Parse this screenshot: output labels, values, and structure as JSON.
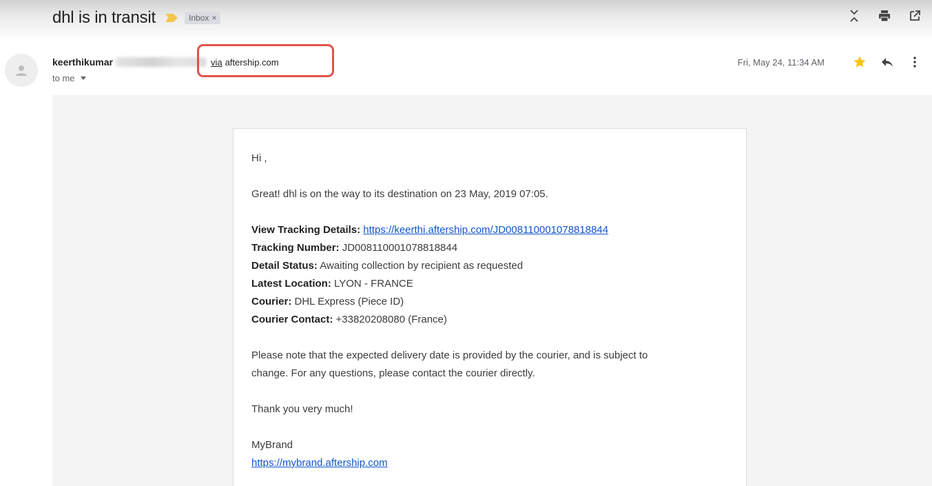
{
  "header": {
    "subject": "dhl is in transit",
    "label": "Inbox",
    "label_close": "×"
  },
  "toolbar": {
    "icons": [
      "expand-collapse-icon",
      "print-icon",
      "open-new-window-icon"
    ]
  },
  "message": {
    "sender_name": "keerthikumar",
    "via_text": "via",
    "via_domain": "aftership.com",
    "recipient": "to me",
    "date": "Fri, May 24, 11:34 AM",
    "icons": [
      "star-icon",
      "reply-icon",
      "more-vert-icon"
    ],
    "star_color": "#f5c518",
    "highlight_color": "#e0524b"
  },
  "body": {
    "greeting": "Hi ,",
    "intro": "Great! dhl is on the way to its destination on 23 May, 2019 07:05.",
    "tracking_label": "View Tracking Details:",
    "tracking_link": "https://keerthi.aftership.com/JD008110001078818844",
    "number_label": "Tracking Number:",
    "number_value": "JD008110001078818844",
    "status_label": "Detail Status:",
    "status_value": "Awaiting collection by recipient as requested",
    "location_label": "Latest Location:",
    "location_value": "LYON - FRANCE",
    "courier_label": "Courier:",
    "courier_value": "DHL Express (Piece ID)",
    "contact_label": "Courier Contact:",
    "contact_value": "+33820208080 (France)",
    "note_line1": "Please note that the expected delivery date is provided by the courier, and is subject to",
    "note_line2": "change. For any questions, please contact the courier directly.",
    "thanks": "Thank you very much!",
    "brand": "MyBrand",
    "brand_link": "https://mybrand.aftership.com"
  }
}
